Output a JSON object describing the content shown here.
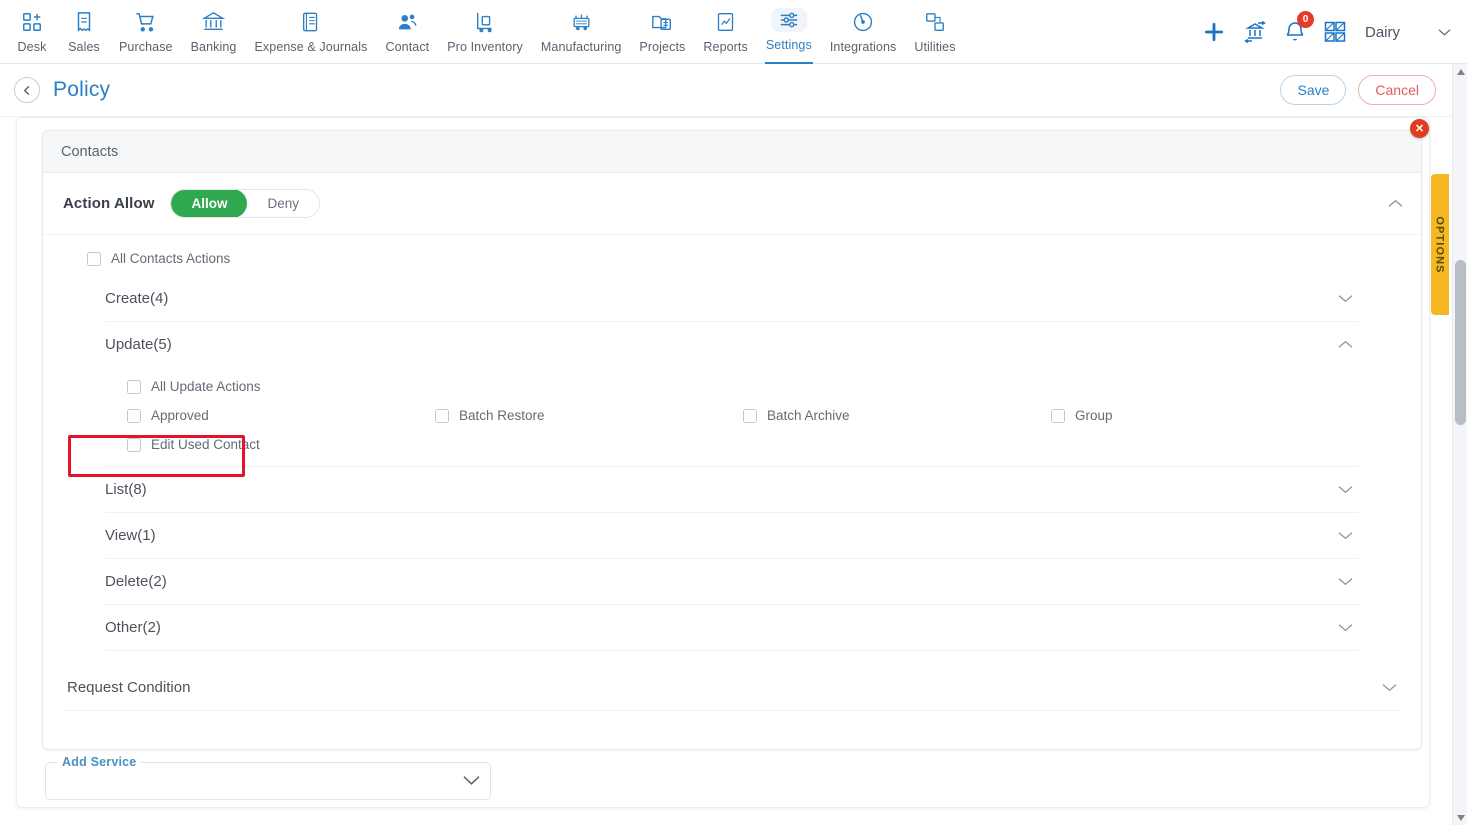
{
  "nav": {
    "items": [
      {
        "label": "Desk",
        "icon": "desk-grid-plus-icon"
      },
      {
        "label": "Sales",
        "icon": "sales-receipt-icon"
      },
      {
        "label": "Purchase",
        "icon": "purchase-cart-icon"
      },
      {
        "label": "Banking",
        "icon": "bank-building-icon"
      },
      {
        "label": "Expense & Journals",
        "icon": "journal-book-icon"
      },
      {
        "label": "Contact",
        "icon": "contact-people-icon"
      },
      {
        "label": "Pro Inventory",
        "icon": "inventory-trolley-icon"
      },
      {
        "label": "Manufacturing",
        "icon": "manufacturing-machine-icon"
      },
      {
        "label": "Projects",
        "icon": "projects-folder-icon"
      },
      {
        "label": "Reports",
        "icon": "reports-chart-icon"
      },
      {
        "label": "Settings",
        "icon": "settings-sliders-icon"
      },
      {
        "label": "Integrations",
        "icon": "integrations-plug-icon"
      },
      {
        "label": "Utilities",
        "icon": "utilities-shapes-icon"
      }
    ],
    "active_index": 10,
    "right": {
      "add_icon": "plus-icon",
      "bank_transfer_icon": "bank-transfer-icon",
      "notification_icon": "bell-icon",
      "notification_count": "0",
      "apps_icon": "apps-grid-icon",
      "org_name": "Dairy",
      "org_caret_icon": "chevron-down-icon"
    }
  },
  "page_header": {
    "back_icon": "chevron-left-icon",
    "title": "Policy",
    "save_label": "Save",
    "cancel_label": "Cancel"
  },
  "close_badge": {
    "icon": "close-icon",
    "glyph": "✕"
  },
  "options_tab": {
    "label": "OPTIONS"
  },
  "service": {
    "title": "Contacts",
    "action_allow": {
      "label": "Action Allow",
      "options": [
        "Allow",
        "Deny"
      ],
      "selected": "Allow",
      "collapse_icon": "chevron-up-icon"
    },
    "all_actions": {
      "label": "All Contacts Actions",
      "checked": false
    },
    "groups": [
      {
        "label": "Create(4)",
        "expanded": false,
        "chevron": "chevron-down-icon",
        "all_label": "",
        "items": []
      },
      {
        "label": "Update(5)",
        "expanded": true,
        "chevron": "chevron-up-icon",
        "all_label": "All Update Actions",
        "items": [
          {
            "label": "Approved",
            "checked": false
          },
          {
            "label": "Batch Restore",
            "checked": false
          },
          {
            "label": "Batch Archive",
            "checked": false
          },
          {
            "label": "Group",
            "checked": false
          },
          {
            "label": "Edit Used Contact",
            "checked": false,
            "highlighted": true
          }
        ]
      },
      {
        "label": "List(8)",
        "expanded": false,
        "chevron": "chevron-down-icon",
        "all_label": "",
        "items": []
      },
      {
        "label": "View(1)",
        "expanded": false,
        "chevron": "chevron-down-icon",
        "all_label": "",
        "items": []
      },
      {
        "label": "Delete(2)",
        "expanded": false,
        "chevron": "chevron-down-icon",
        "all_label": "",
        "items": []
      },
      {
        "label": "Other(2)",
        "expanded": false,
        "chevron": "chevron-down-icon",
        "all_label": "",
        "items": []
      }
    ],
    "request_condition": {
      "label": "Request Condition",
      "chevron": "chevron-down-icon"
    }
  },
  "add_service": {
    "label": "Add Service",
    "value": "",
    "caret_icon": "chevron-down-icon"
  },
  "colors": {
    "accent_blue": "#2b7fc4",
    "allow_green": "#2fa84f",
    "cancel_red": "#e05c5c",
    "annotation_red": "#e5142c",
    "options_yellow": "#f5b820",
    "badge_red": "#e8392b"
  }
}
